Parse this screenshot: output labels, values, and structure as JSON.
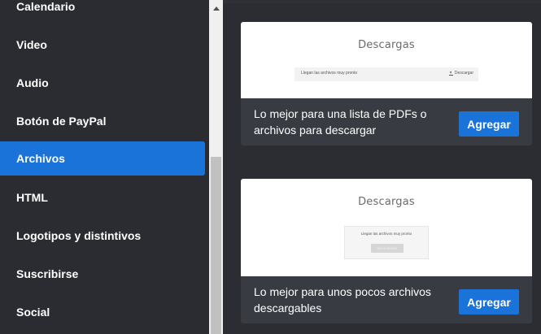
{
  "sidebar": {
    "items": [
      {
        "label": "Calendario"
      },
      {
        "label": "Video"
      },
      {
        "label": "Audio"
      },
      {
        "label": "Botón de PayPal"
      },
      {
        "label": "Archivos"
      },
      {
        "label": "HTML"
      },
      {
        "label": "Logotipos y distintivos"
      },
      {
        "label": "Suscribirse"
      },
      {
        "label": "Social"
      }
    ],
    "active_index": 4
  },
  "cards": [
    {
      "preview_title": "Descargas",
      "preview_row_text": "Llegan las archivos muy pronto",
      "preview_download_label": "Descargar",
      "description": "Lo mejor para una lista de PDFs o archivos para descargar",
      "button_label": "Agregar"
    },
    {
      "preview_title": "Descargas",
      "preview_box_text": "Llegan las archivos muy pronto",
      "preview_button_label": "DESCARGAR",
      "description": "Lo mejor para unos pocos archivos descargables",
      "button_label": "Agregar"
    }
  ],
  "colors": {
    "accent": "#1a73d9",
    "sidebar_bg": "#2a2c31",
    "card_footer_bg": "#393b42"
  }
}
